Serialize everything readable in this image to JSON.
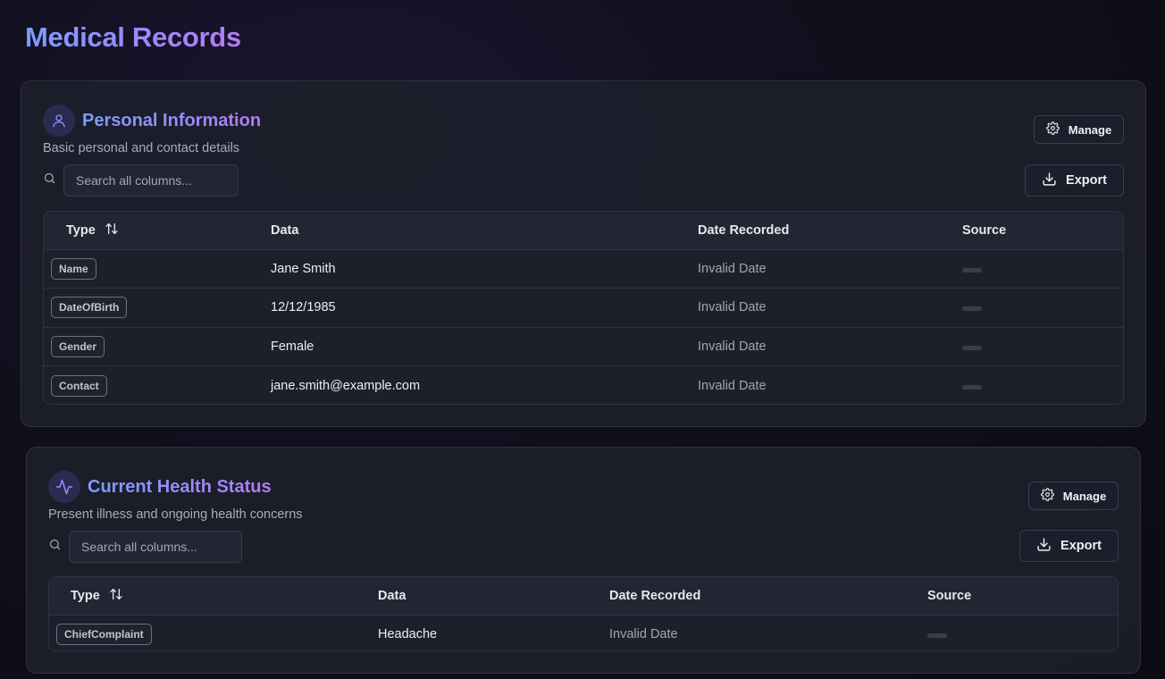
{
  "page": {
    "title": "Medical Records"
  },
  "sections": [
    {
      "title": "Personal Information",
      "description": "Basic personal and contact details",
      "icon": "user-icon",
      "search_placeholder": "Search all columns...",
      "manage_label": "Manage",
      "export_label": "Export",
      "columns": [
        "Type",
        "Data",
        "Date Recorded",
        "Source"
      ],
      "rows": [
        {
          "type": "Name",
          "data": "Jane Smith",
          "date": "Invalid Date"
        },
        {
          "type": "DateOfBirth",
          "data": "12/12/1985",
          "date": "Invalid Date"
        },
        {
          "type": "Gender",
          "data": "Female",
          "date": "Invalid Date"
        },
        {
          "type": "Contact",
          "data": "jane.smith@example.com",
          "date": "Invalid Date"
        }
      ]
    },
    {
      "title": "Current Health Status",
      "description": "Present illness and ongoing health concerns",
      "icon": "activity-icon",
      "search_placeholder": "Search all columns...",
      "manage_label": "Manage",
      "export_label": "Export",
      "columns": [
        "Type",
        "Data",
        "Date Recorded",
        "Source"
      ],
      "rows": [
        {
          "type": "ChiefComplaint",
          "data": "Headache",
          "date": "Invalid Date"
        }
      ]
    }
  ],
  "colors": {
    "accent_start": "#7c9cff",
    "accent_end": "#b27cf5",
    "background": "#110f1c",
    "card": "#1c1f2a"
  }
}
